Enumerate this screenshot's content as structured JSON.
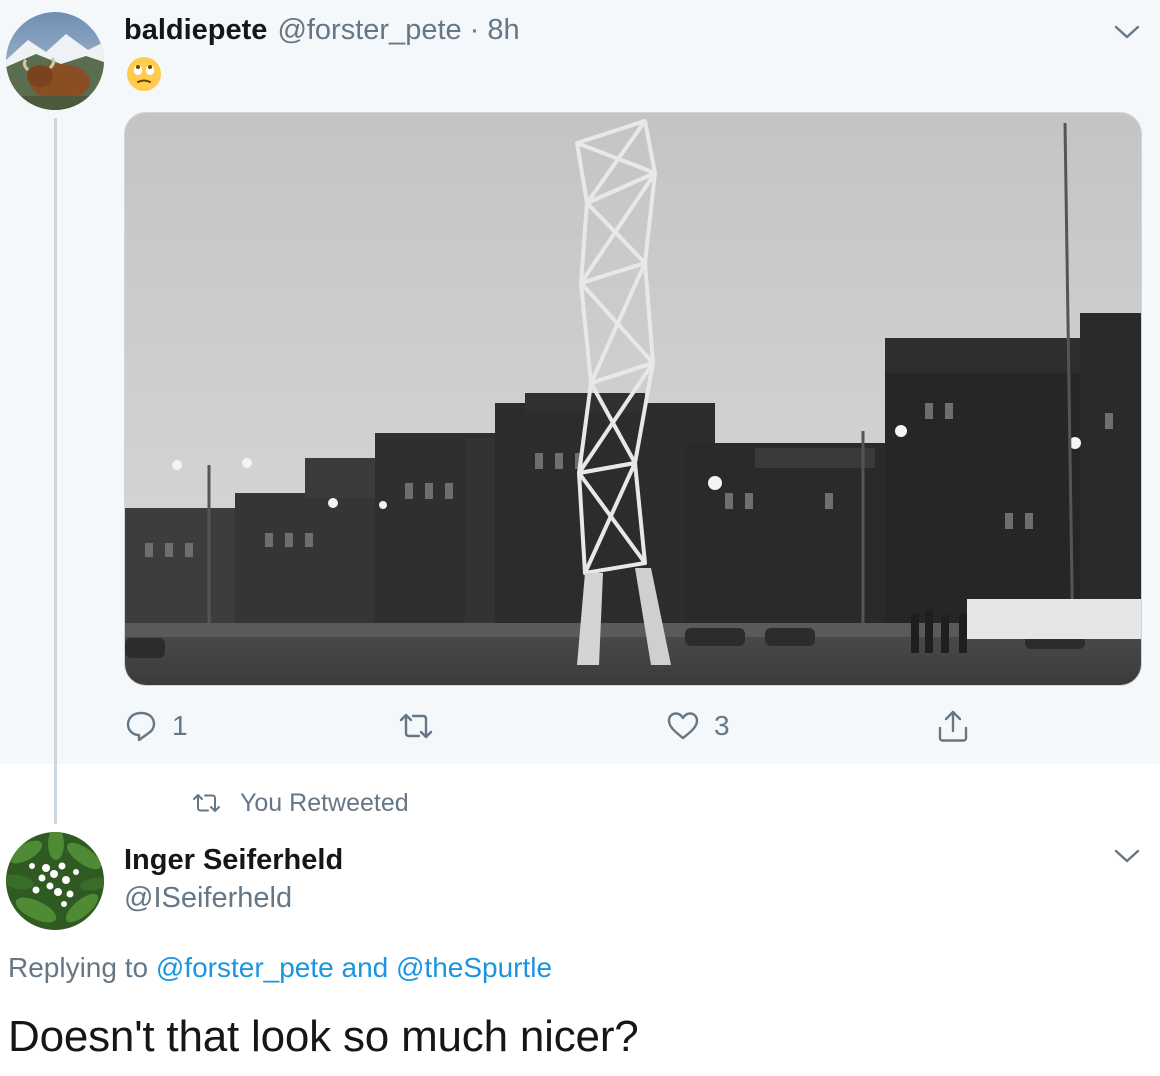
{
  "tweet1": {
    "display_name": "baldiepete",
    "handle": "@forster_pete",
    "separator": "·",
    "time": "8h",
    "emoji": "face-with-rolling-eyes",
    "media_description_icon": "photo",
    "actions": {
      "reply_count": "1",
      "retweet_count": "",
      "like_count": "3"
    }
  },
  "retweet_context": {
    "label": "You Retweeted"
  },
  "tweet2": {
    "display_name": "Inger Seiferheld",
    "handle": "@ISeiferheld",
    "replying_prefix": "Replying to",
    "replying_user1": "@forster_pete",
    "replying_and": "and",
    "replying_user2": "@theSpurtle",
    "text": "Doesn't that look so much nicer?"
  },
  "colors": {
    "background_highlight": "#f5f8fa",
    "primary_text": "#14171a",
    "secondary_text": "#657786",
    "link": "#1b95e0",
    "divider": "#ccd6dd"
  },
  "icons": [
    "caret-down-icon",
    "reply-icon",
    "retweet-icon",
    "like-icon",
    "share-icon",
    "retweet-small-icon"
  ]
}
